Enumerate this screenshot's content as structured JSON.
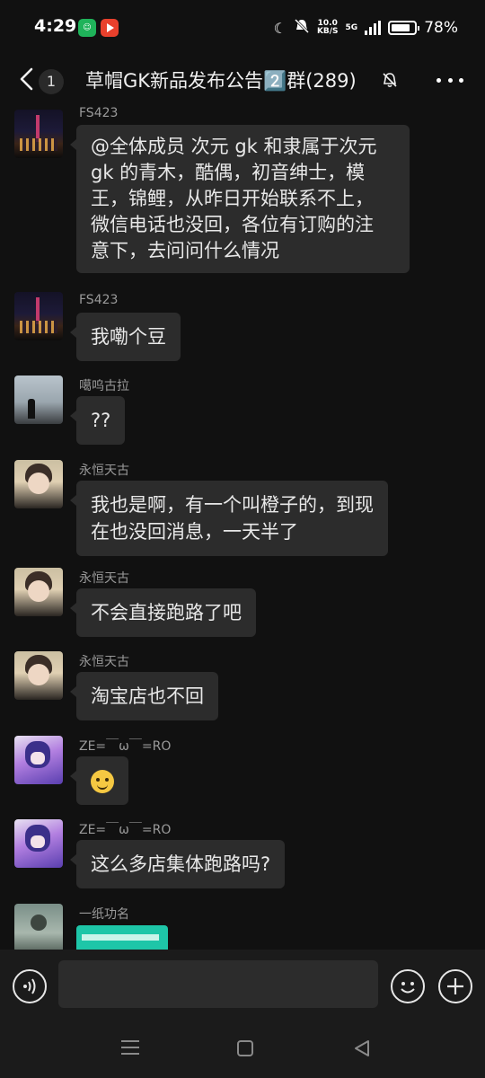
{
  "status_bar": {
    "time": "4:29",
    "app_icon_1": "wechat-green-icon",
    "app_icon_2": "video-red-icon",
    "net_speed_value": "10.0",
    "net_speed_unit": "KB/S",
    "network_type": "5G",
    "battery_percent": "78%"
  },
  "header": {
    "unread_count": "1",
    "title": "草帽GK新品发布公告2️⃣群(289)",
    "muted": true
  },
  "messages": [
    {
      "sender": "FS423",
      "avatar": "city-night-avatar",
      "lines": [
        "@全体成员 次元 gk 和隶属于次元",
        "gk 的青木，酷偶，初音绅士，模",
        "王，锦鲤，从昨日开始联系不上，",
        "微信电话也没回，各位有订购的注",
        "意下，去问问什么情况"
      ]
    },
    {
      "sender": "FS423",
      "avatar": "city-night-avatar",
      "lines": [
        "我嘞个豆"
      ]
    },
    {
      "sender": "噶呜古拉",
      "avatar": "foggy-man-avatar",
      "lines": [
        "??"
      ]
    },
    {
      "sender": "永恒天古",
      "avatar": "boy-portrait-avatar",
      "lines": [
        "我也是啊，有一个叫橙子的，到现",
        "在也没回消息，一天半了"
      ]
    },
    {
      "sender": "永恒天古",
      "avatar": "boy-portrait-avatar",
      "lines": [
        "不会直接跑路了吧"
      ]
    },
    {
      "sender": "永恒天古",
      "avatar": "boy-portrait-avatar",
      "lines": [
        "淘宝店也不回"
      ]
    },
    {
      "sender": "ZE=￣ω￣=RO",
      "avatar": "anime-girl-avatar",
      "emoji": "smile-emoji"
    },
    {
      "sender": "ZE=￣ω￣=RO",
      "avatar": "anime-girl-avatar",
      "lines": [
        "这么多店集体跑路吗?"
      ]
    },
    {
      "sender": "一纸功名",
      "avatar": "sketch-boy-avatar",
      "image": "screenshot-thumbnail"
    }
  ],
  "input_bar": {
    "placeholder": "",
    "voice_icon": "voice-icon",
    "emoji_icon": "emoji-icon",
    "plus_icon": "plus-icon"
  },
  "nav_bar": {
    "menu_icon": "recent-apps-icon",
    "home_icon": "home-icon",
    "back_icon": "back-icon"
  },
  "colors": {
    "background": "#111111",
    "bubble": "#2c2c2c",
    "text": "#e8e8e8",
    "sender": "#9a9a9a"
  }
}
